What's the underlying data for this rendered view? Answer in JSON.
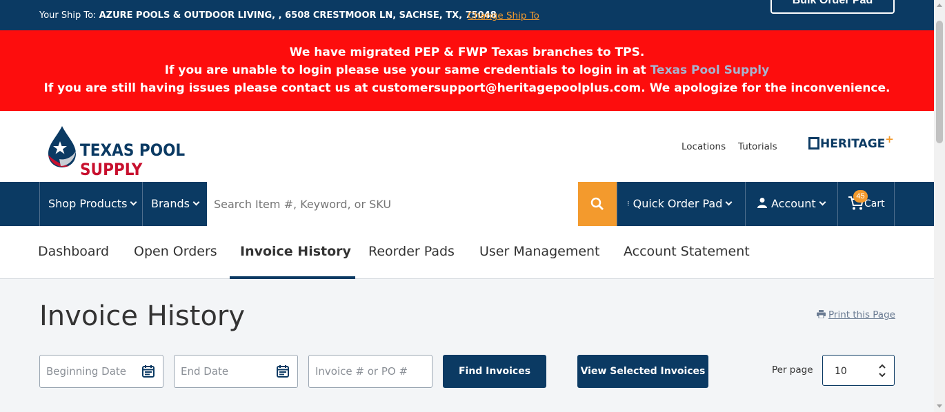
{
  "topbar": {
    "shipto_prefix": "Your Ship To: ",
    "shipto_value": "AZURE POOLS & OUTDOOR LIVING, , 6508 CRESTMOOR LN, SACHSE, TX, 75048",
    "change_ship": "Change Ship To",
    "bulk_order": "Bulk Order Pad"
  },
  "alert": {
    "line1": "We have migrated PEP & FWP Texas branches to TPS.",
    "line2_prefix": "If you are unable to login please use your same credentials to login in at ",
    "line2_link": "Texas Pool Supply",
    "line3": "If you are still having issues please contact us at customersupport@heritagepoolplus.com. We apologize for the inconvenience."
  },
  "header": {
    "logo_text_1": "TEXAS POOL ",
    "logo_text_2": "SUPPLY",
    "locations": "Locations",
    "tutorials": "Tutorials",
    "heritage": "HERITAGE",
    "heritage_plus": "+"
  },
  "nav": {
    "shop_products": "Shop Products",
    "brands": "Brands",
    "search_placeholder": "Search Item #, Keyword, or SKU",
    "quick_order": "Quick Order Pad",
    "account": "Account",
    "cart": "Cart",
    "cart_count": "45"
  },
  "tabs": [
    "Dashboard",
    "Open Orders",
    "Invoice History",
    "Reorder Pads",
    "User Management",
    "Account Statement"
  ],
  "main": {
    "title": "Invoice History",
    "print": "Print this Page",
    "beginning_date_placeholder": "Beginning Date",
    "end_date_placeholder": "End Date",
    "invoice_placeholder": "Invoice # or PO #",
    "find_invoices": "Find Invoices",
    "view_selected": "View Selected Invoices",
    "per_page_label": "Per page",
    "per_page_value": "10"
  },
  "colors": {
    "navy": "#0b3a63",
    "orange": "#f39a2d",
    "alert_red": "#fd0d0d"
  }
}
